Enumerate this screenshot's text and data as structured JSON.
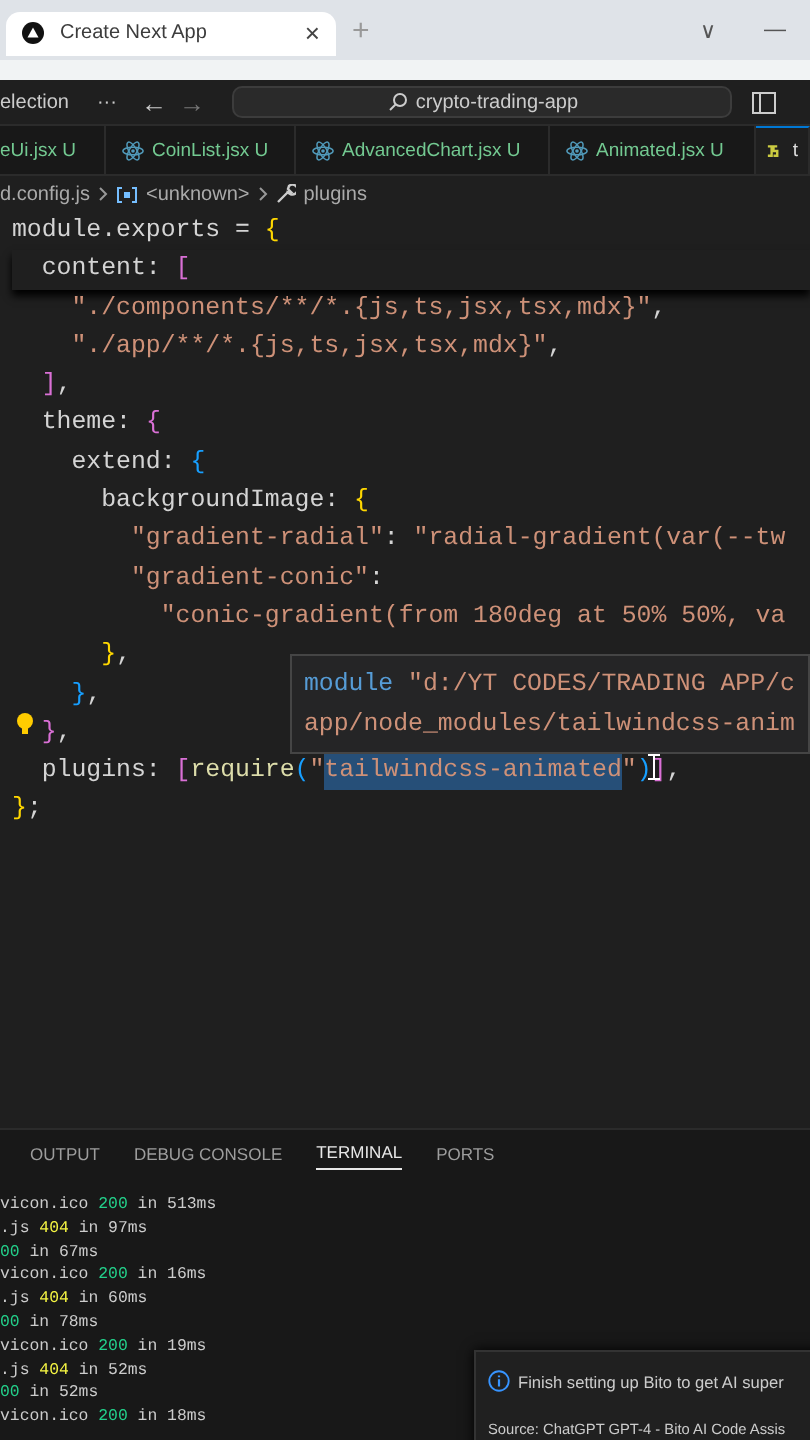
{
  "browser": {
    "tab_title": "Create Next App",
    "close": "×",
    "new_tab": "+",
    "tab_list": "∨",
    "minimize": "—"
  },
  "title_bar": {
    "menu_item": "election",
    "more": "···",
    "back": "←",
    "forward": "→",
    "search": "crypto-trading-app"
  },
  "editor_tabs": [
    {
      "label": "eUi.jsx",
      "status": "U",
      "selected": false
    },
    {
      "label": "CoinList.jsx",
      "status": "U",
      "kind": "react",
      "selected": false
    },
    {
      "label": "AdvancedChart.jsx",
      "status": "U",
      "kind": "react",
      "selected": false
    },
    {
      "label": "Animated.jsx",
      "status": "U",
      "kind": "react",
      "selected": false
    },
    {
      "label": "t",
      "kind": "js",
      "selected": true
    }
  ],
  "breadcrumb": [
    "d.config.js",
    "<unknown>",
    "plugins"
  ],
  "code_lines": [
    [
      {
        "text": "module.exports = ",
        "kind": "plain"
      },
      {
        "text": "{",
        "kind": "b1"
      }
    ],
    [
      {
        "text": "  content: ",
        "kind": "plain"
      },
      {
        "text": "[",
        "kind": "b2"
      }
    ],
    [
      {
        "text": "    \"./components/**/*.{js,ts,jsx,tsx,mdx}\"",
        "kind": "string"
      },
      {
        "text": ",",
        "kind": "plain"
      }
    ],
    [
      {
        "text": "    \"./app/**/*.{js,ts,jsx,tsx,mdx}\"",
        "kind": "string"
      },
      {
        "text": ",",
        "kind": "plain"
      }
    ],
    [
      {
        "text": "  ]",
        "kind": "b2"
      },
      {
        "text": ",",
        "kind": "plain"
      }
    ],
    [
      {
        "text": "  theme: ",
        "kind": "plain"
      },
      {
        "text": "{",
        "kind": "b2"
      }
    ],
    [
      {
        "text": "    extend: ",
        "kind": "plain"
      },
      {
        "text": "{",
        "kind": "b3"
      }
    ],
    [
      {
        "text": "      backgroundImage: ",
        "kind": "plain"
      },
      {
        "text": "{",
        "kind": "b1"
      }
    ],
    [
      {
        "text": "        \"gradient-radial\"",
        "kind": "string"
      },
      {
        "text": ": ",
        "kind": "plain"
      },
      {
        "text": "\"radial-gradient(var(--tw",
        "kind": "string"
      }
    ],
    [
      {
        "text": "        \"gradient-conic\"",
        "kind": "string"
      },
      {
        "text": ":",
        "kind": "plain"
      }
    ],
    [
      {
        "text": "          \"conic-gradient(from 180deg at 50% 50%, va",
        "kind": "string"
      }
    ],
    [
      {
        "text": "      }",
        "kind": "b1"
      },
      {
        "text": ",",
        "kind": "plain"
      }
    ],
    [
      {
        "text": "    }",
        "kind": "b3"
      },
      {
        "text": ",",
        "kind": "plain"
      }
    ],
    [
      {
        "text": "  }",
        "kind": "b2"
      },
      {
        "text": ",",
        "kind": "plain"
      }
    ],
    [
      {
        "text": "  plugins: ",
        "kind": "plain"
      },
      {
        "text": "[",
        "kind": "b2"
      },
      {
        "text": "require",
        "kind": "func"
      },
      {
        "text": "(",
        "kind": "b3"
      },
      {
        "text": "\"",
        "kind": "string"
      },
      {
        "text": "tailwindcss-animated",
        "kind": "selected"
      },
      {
        "text": "\"",
        "kind": "string"
      },
      {
        "text": ")",
        "kind": "b3"
      },
      {
        "text": "]",
        "kind": "b2"
      },
      {
        "text": ",",
        "kind": "plain"
      }
    ],
    [
      {
        "text": "}",
        "kind": "b1"
      },
      {
        "text": ";",
        "kind": "plain"
      }
    ]
  ],
  "hover_tooltip": {
    "keyword": "module",
    "path_line_1": "\"d:/YT CODES/TRADING APP/c",
    "path_line_2": "app/node_modules/tailwindcss-anim"
  },
  "panel_tabs": [
    {
      "label": "OUTPUT",
      "selected": false
    },
    {
      "label": "DEBUG CONSOLE",
      "selected": false
    },
    {
      "label": "TERMINAL",
      "selected": true
    },
    {
      "label": "PORTS",
      "selected": false
    }
  ],
  "terminal_lines": [
    {
      "prefix": "vicon.ico ",
      "status": "200",
      "rest": " in 513ms",
      "kind": "ok"
    },
    {
      "prefix": ".js ",
      "status": "404",
      "rest": " in 97ms",
      "kind": "missing"
    },
    {
      "status": "00",
      "rest": " in 67ms",
      "kind": "ok"
    },
    {
      "prefix": "vicon.ico ",
      "status": "200",
      "rest": " in 16ms",
      "kind": "ok"
    },
    {
      "prefix": ".js ",
      "status": "404",
      "rest": " in 60ms",
      "kind": "missing"
    },
    {
      "status": "00",
      "rest": " in 78ms",
      "kind": "ok"
    },
    {
      "prefix": "vicon.ico ",
      "status": "200",
      "rest": " in 19ms",
      "kind": "ok"
    },
    {
      "prefix": ".js ",
      "status": "404",
      "rest": " in 52ms",
      "kind": "missing"
    },
    {
      "status": "00",
      "rest": " in 52ms",
      "kind": "ok"
    },
    {
      "prefix": "vicon.ico ",
      "status": "200",
      "rest": " in 18ms",
      "kind": "ok"
    }
  ],
  "notification": {
    "message": "Finish setting up Bito to get AI super",
    "source": "Source: ChatGPT GPT-4 - Bito AI Code Assis"
  }
}
